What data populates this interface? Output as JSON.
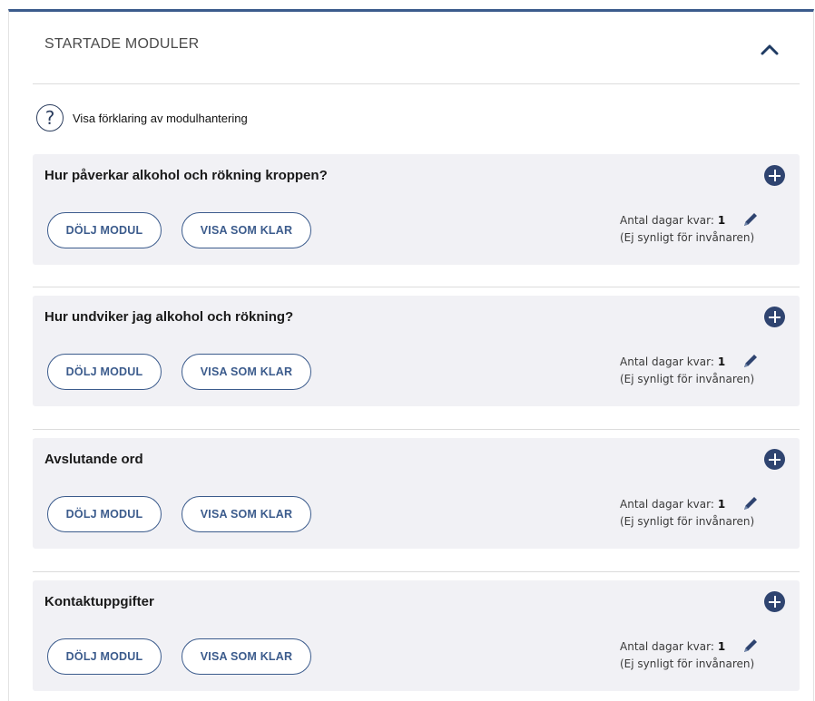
{
  "panel": {
    "title": "STARTADE MODULER",
    "help_text": "Visa förklaring av modulhantering"
  },
  "icons": {
    "collapse": "chevron-up-icon",
    "help": "question-circle-icon",
    "add": "plus-circle-icon",
    "edit": "pencil-icon"
  },
  "colors": {
    "accent": "#3b5b8c",
    "dark_navy": "#2f4470",
    "card_bg": "#f1f1f5"
  },
  "modules": [
    {
      "title": "Hur påverkar alkohol och rökning kroppen?",
      "hide_label": "DÖLJ MODUL",
      "done_label": "VISA SOM KLAR",
      "days_label": "Antal dagar kvar:",
      "days_value": "1",
      "visibility_note": "(Ej synligt för invånaren)"
    },
    {
      "title": "Hur undviker jag alkohol och rökning?",
      "hide_label": "DÖLJ MODUL",
      "done_label": "VISA SOM KLAR",
      "days_label": "Antal dagar kvar:",
      "days_value": "1",
      "visibility_note": "(Ej synligt för invånaren)"
    },
    {
      "title": "Avslutande ord",
      "hide_label": "DÖLJ MODUL",
      "done_label": "VISA SOM KLAR",
      "days_label": "Antal dagar kvar:",
      "days_value": "1",
      "visibility_note": "(Ej synligt för invånaren)"
    },
    {
      "title": "Kontaktuppgifter",
      "hide_label": "DÖLJ MODUL",
      "done_label": "VISA SOM KLAR",
      "days_label": "Antal dagar kvar:",
      "days_value": "1",
      "visibility_note": "(Ej synligt för invånaren)"
    }
  ]
}
